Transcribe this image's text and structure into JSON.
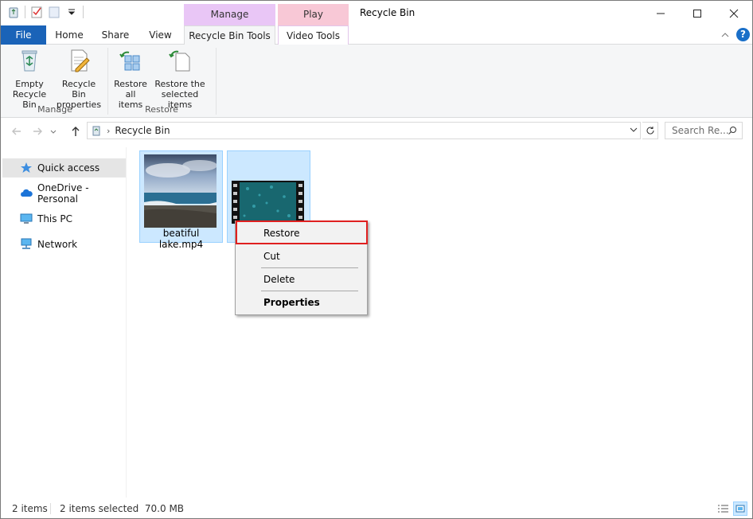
{
  "window": {
    "title": "Recycle Bin",
    "contextual_groups": {
      "manage": "Manage",
      "play": "Play"
    }
  },
  "ribbon_tabs": {
    "file": "File",
    "home": "Home",
    "share": "Share",
    "view": "View",
    "recycle_bin_tools": "Recycle Bin Tools",
    "video_tools": "Video Tools"
  },
  "ribbon": {
    "empty_line1": "Empty",
    "empty_line2": "Recycle Bin",
    "props_line1": "Recycle Bin",
    "props_line2": "properties",
    "restore_all_line1": "Restore",
    "restore_all_line2": "all items",
    "restore_sel_line1": "Restore the",
    "restore_sel_line2": "selected items",
    "group_manage": "Manage",
    "group_restore": "Restore"
  },
  "address": {
    "path": "Recycle Bin",
    "search_placeholder": "Search Re..."
  },
  "nav": {
    "items": [
      {
        "label": "Quick access"
      },
      {
        "label": "OneDrive - Personal"
      },
      {
        "label": "This PC"
      },
      {
        "label": "Network"
      }
    ]
  },
  "files": [
    {
      "name": "beatiful lake.mp4"
    },
    {
      "name": ""
    }
  ],
  "context_menu": {
    "restore": "Restore",
    "cut": "Cut",
    "delete": "Delete",
    "properties": "Properties"
  },
  "status": {
    "count": "2 items",
    "selection": "2 items selected  70.0 MB"
  },
  "colors": {
    "accent": "#1a63b8",
    "selection": "#cce8ff",
    "highlight": "#e02020"
  }
}
